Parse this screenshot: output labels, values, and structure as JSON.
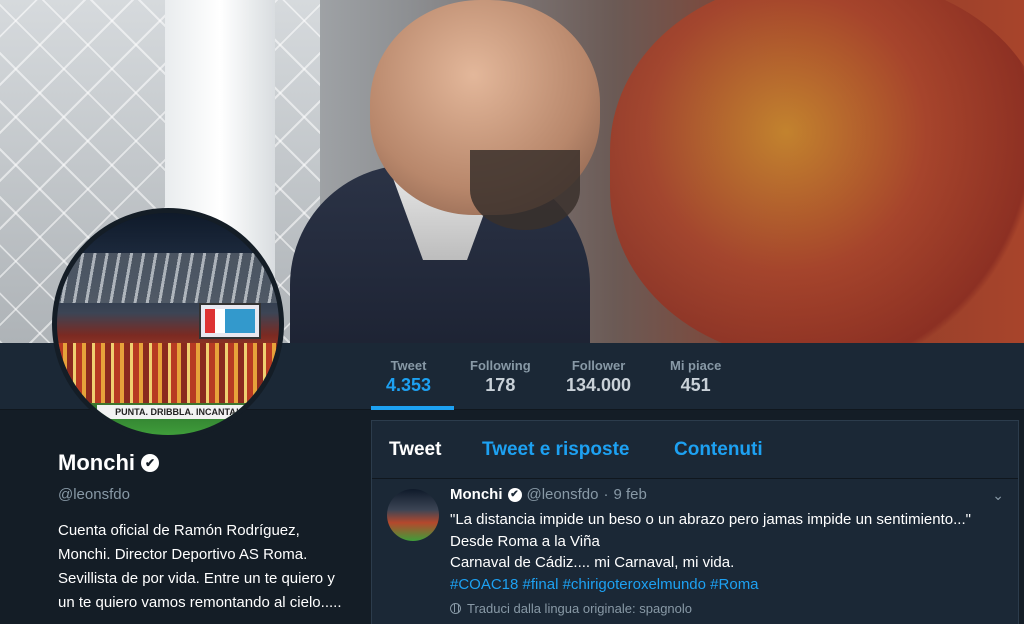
{
  "profile": {
    "name": "Monchi",
    "handle": "@leonsfdo",
    "bio": "Cuenta oficial de Ramón Rodríguez, Monchi. Director Deportivo AS Roma. Sevillista de por vida. Entre un te quiero y un te quiero vamos remontando al cielo.....",
    "avatar_banner_text": "PUNTA. DRIBBLA. INCANTA!"
  },
  "stats": [
    {
      "label": "Tweet",
      "value": "4.353"
    },
    {
      "label": "Following",
      "value": "178"
    },
    {
      "label": "Follower",
      "value": "134.000"
    },
    {
      "label": "Mi piace",
      "value": "451"
    }
  ],
  "tabs": [
    {
      "label": "Tweet"
    },
    {
      "label": "Tweet e risposte"
    },
    {
      "label": "Contenuti"
    }
  ],
  "tweet": {
    "name": "Monchi",
    "handle": "@leonsfdo",
    "dot": "·",
    "date": "9 feb",
    "line1": "\"La distancia impide un beso o un abrazo pero jamas impide un sentimiento...\"",
    "line2": "Desde Roma a la Viña",
    "line3": "Carnaval de Cádiz.... mi Carnaval, mi vida.",
    "hashtags": [
      "#COAC18",
      "#final",
      "#chirigoteroxelmundo",
      "#Roma"
    ],
    "translate": "Traduci dalla lingua originale: spagnolo"
  },
  "icons": {
    "verified": "✔",
    "caret": "⌄"
  },
  "colors": {
    "accent": "#1da1f2",
    "background": "#141d26",
    "panel": "#1b2836",
    "muted": "#8899a6"
  }
}
